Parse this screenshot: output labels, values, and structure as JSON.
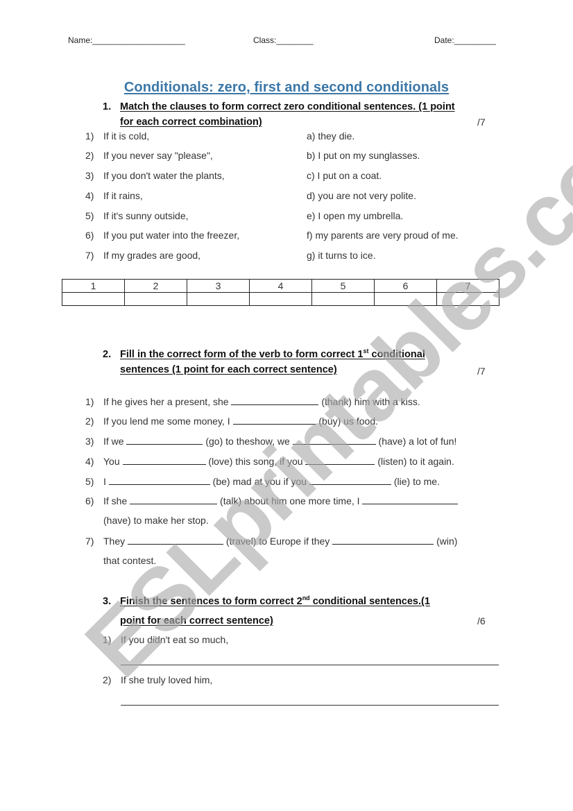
{
  "header": {
    "name_label": "Name:____________________",
    "class_label": "Class:________",
    "date_label": "Date:_________"
  },
  "title": "Conditionals: zero, first and second conditionals",
  "title_color": "#3b77a8",
  "watermark": "ESLprintables.com",
  "section1": {
    "number": "1.",
    "instruction_line1": "Match the clauses to form correct zero conditional sentences. (1 point",
    "instruction_line2": "for each correct combination)",
    "score": "/7",
    "clauses": [
      {
        "num": "1)",
        "text": "If it is cold,"
      },
      {
        "num": "2)",
        "text": "If you never say \"please\","
      },
      {
        "num": "3)",
        "text": "If you don't water the plants,"
      },
      {
        "num": "4)",
        "text": "If it rains,"
      },
      {
        "num": "5)",
        "text": "If it's sunny outside,"
      },
      {
        "num": "6)",
        "text": "If you put water into the freezer,"
      },
      {
        "num": "7)",
        "text": "If my grades are good,"
      }
    ],
    "results": [
      "a) they die.",
      "b) I put on my sunglasses.",
      "c) I put on a coat.",
      "d) you are not very polite.",
      "e) I open my umbrella.",
      "f) my parents are very proud of me.",
      "g) it turns to ice."
    ],
    "table_headers": [
      "1",
      "2",
      "3",
      "4",
      "5",
      "6",
      "7"
    ],
    "table_answers": [
      "",
      "",
      "",
      "",
      "",
      "",
      ""
    ]
  },
  "section2": {
    "number": "2.",
    "instruction_line1_pre": "Fill in the correct form of the verb to form correct 1",
    "instruction_sup": "st",
    "instruction_line1_post": " conditional",
    "instruction_line2": "sentences (1 point for each correct sentence)",
    "score": "/7",
    "items": [
      {
        "num": "1)",
        "parts": [
          "If he gives her a present, she ",
          " (thank) him with a kiss."
        ]
      },
      {
        "num": "2)",
        "parts": [
          "If you lend me some money, I ",
          " (buy) us food."
        ]
      },
      {
        "num": "3)",
        "parts": [
          "If we ",
          " (go) to theshow, we ",
          " (have) a lot of fun!"
        ]
      },
      {
        "num": "4)",
        "parts": [
          "You ",
          " (love) this song, if you ",
          " (listen) to it again."
        ]
      },
      {
        "num": "5)",
        "parts": [
          "I ",
          " (be) mad at you if you ",
          " (lie) to me."
        ]
      },
      {
        "num": "6)",
        "parts": [
          "If she ",
          " (talk) about him one more time, I "
        ],
        "continuation": "(have) to make her stop."
      },
      {
        "num": "7)",
        "parts": [
          "They ",
          " (travel) to Europe if they ",
          " (win)"
        ],
        "continuation": "that contest."
      }
    ]
  },
  "section3": {
    "number": "3.",
    "instruction_line1_pre": "Finish the sentences to form correct 2",
    "instruction_sup": "nd",
    "instruction_line1_post": " conditional sentences.(1",
    "instruction_line2": "point for each correct sentence)",
    "score": "/6",
    "items": [
      {
        "num": "1)",
        "text": "If you didn't eat so much,"
      },
      {
        "num": "2)",
        "text": "If she truly loved him,"
      }
    ]
  }
}
